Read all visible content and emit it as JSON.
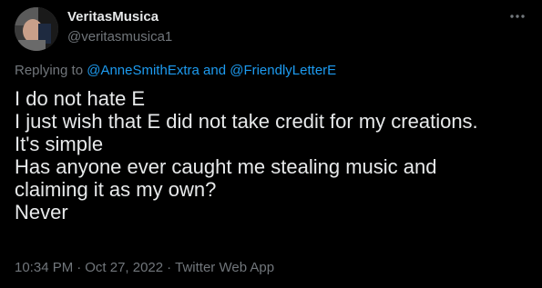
{
  "tweet": {
    "author": {
      "display_name": "VeritasMusica",
      "handle": "@veritasmusica1"
    },
    "more_icon": "more-horizontal-icon",
    "replying": {
      "prefix": "Replying to",
      "user1": "@AnneSmithExtra",
      "conjunction": "and",
      "user2": "@FriendlyLetterE"
    },
    "lines": [
      "I do not hate E",
      "I just wish that E did not take credit for my creations.",
      "It's simple",
      "Has anyone ever caught me stealing music and",
      "claiming it as my own?",
      "Never"
    ],
    "time": "10:34 PM",
    "separator": "·",
    "date": "Oct 27, 2022",
    "source": "Twitter Web App"
  },
  "colors": {
    "background": "#000000",
    "text": "#e7e9ea",
    "secondary": "#71767b",
    "link": "#1d9bf0"
  }
}
